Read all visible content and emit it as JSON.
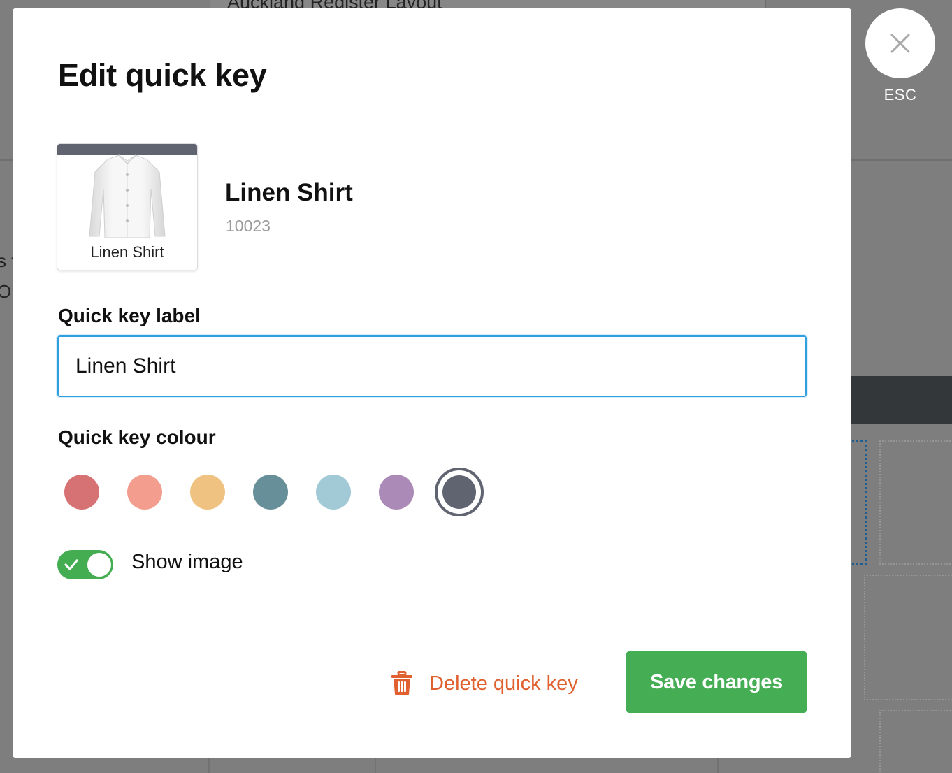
{
  "background": {
    "layout_title": "Auckland Register Layout",
    "side_text_1": "s t",
    "side_text_2": "Or"
  },
  "close": {
    "icon": "close-icon",
    "esc_label": "ESC"
  },
  "modal": {
    "title": "Edit quick key",
    "product": {
      "card_label": "Linen Shirt",
      "name": "Linen Shirt",
      "sku": "10023",
      "image_icon": "shirt-image"
    },
    "label_field": {
      "label": "Quick key label",
      "value": "Linen Shirt"
    },
    "colour_field": {
      "label": "Quick key colour",
      "swatches": [
        "#d67174",
        "#f29d8e",
        "#f0c282",
        "#668f99",
        "#a2c9d6",
        "#ab8ab7",
        "#5f6470"
      ],
      "selected": "#5f6470"
    },
    "show_image": {
      "label": "Show image",
      "enabled": true,
      "color": "#44ad52"
    },
    "actions": {
      "delete_label": "Delete quick key",
      "delete_icon": "trash-icon",
      "delete_color": "#e0602f",
      "save_label": "Save changes",
      "save_color": "#45ad54"
    }
  }
}
